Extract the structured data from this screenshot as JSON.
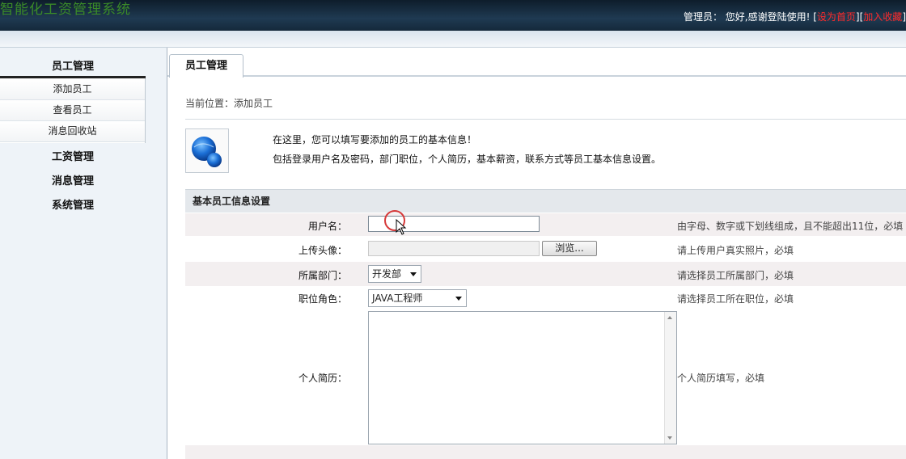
{
  "header": {
    "app_title": "智能化工资管理系统",
    "greeting": "管理员： 您好,感谢登陆使用!",
    "set_home": "设为首页",
    "add_favorite": "加入收藏",
    "bracket_open": "[",
    "bracket_close": "]"
  },
  "sidebar": {
    "sections": [
      {
        "title": "员工管理",
        "items": [
          "添加员工",
          "查看员工",
          "消息回收站"
        ]
      },
      {
        "title": "工资管理"
      },
      {
        "title": "消息管理"
      },
      {
        "title": "系统管理"
      }
    ]
  },
  "main": {
    "tab": "员工管理",
    "breadcrumb": "当前位置：添加员工",
    "intro": {
      "line1": "在这里，您可以填写要添加的员工的基本信息！",
      "line2": "包括登录用户名及密码，部门职位，个人简历，基本薪资，联系方式等员工基本信息设置。"
    },
    "form": {
      "title": "基本员工信息设置",
      "username": {
        "label": "用户名：",
        "value": "",
        "hint": "由字母、数字或下划线组成，且不能超出11位，必填"
      },
      "avatar": {
        "label": "上传头像：",
        "button": "浏览...",
        "hint": "请上传用户真实照片，必填"
      },
      "department": {
        "label": "所属部门：",
        "value": "开发部",
        "hint": "请选择员工所属部门，必填"
      },
      "role": {
        "label": "职位角色：",
        "value": "JAVA工程师",
        "hint": "请选择员工所在职位，必填"
      },
      "resume": {
        "label": "个人简历：",
        "value": "",
        "hint": "个人简历填写，必填"
      }
    }
  },
  "colors": {
    "accent_red": "#ff2a2a",
    "title_green": "#3a8a28",
    "header_dark": "#1f3a52"
  }
}
